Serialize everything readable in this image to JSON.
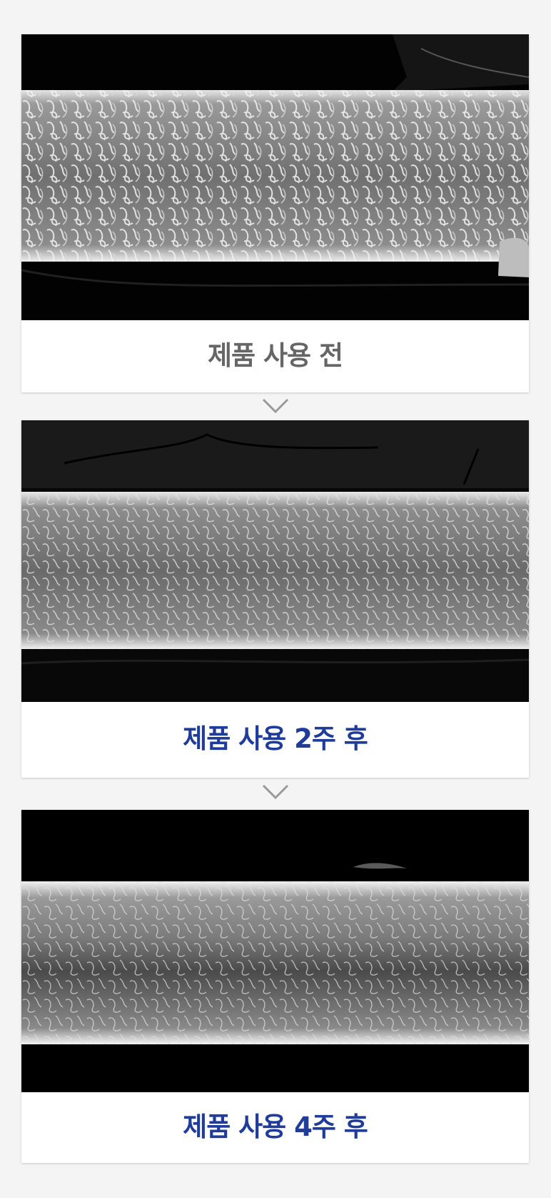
{
  "stages": [
    {
      "caption": "제품 사용 전"
    },
    {
      "caption": "제품 사용 2주 후"
    },
    {
      "caption": "제품 사용 4주 후"
    }
  ],
  "colors": {
    "before_caption": "#666666",
    "after_caption": "#1f3c9a",
    "background": "#f4f4f4"
  },
  "icons": {
    "divider": "chevron-down-icon"
  }
}
